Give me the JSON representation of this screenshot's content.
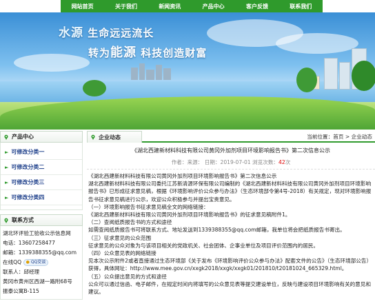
{
  "nav": {
    "items": [
      "网站首页",
      "关于我们",
      "新闻资讯",
      "产品中心",
      "客户反馈",
      "联系我们"
    ]
  },
  "banner": {
    "slogan1_a": "水源",
    "slogan1_b": "生命远远流长",
    "slogan2_a": "转为",
    "slogan2_b": "能源",
    "slogan2_c": "科技创造财富"
  },
  "sidebar": {
    "products_title": "产品中心",
    "categories": [
      "可修改分类一",
      "可修改分类二",
      "可修改分类三",
      "可修改分类四"
    ],
    "contact_title": "联系方式",
    "contact_lines": [
      "湖北环评验工验收公示信息网",
      "电话：13607258477",
      "邮箱：1339388355@qq.com",
      "在线QQ",
      "联系人：邱经理",
      "黄冈市黄州区西湖一路附68号",
      "振泰公寓B-115"
    ],
    "qq_badge": "QQ交谈"
  },
  "content": {
    "tab_title": "企业动态",
    "breadcrumb_prefix": "当前位置：",
    "breadcrumb_home": "首页",
    "breadcrumb_sep": " > ",
    "breadcrumb_current": "企业动态",
    "article_title": "《湖北西建新材料科技有限公司黄冈外加剂项目环境影响报告书》第二次信息公示",
    "meta_author": "作者：来源：",
    "meta_date": "日期：2019-07-01",
    "meta_views_label": "浏览次数：",
    "meta_views": "42",
    "meta_views_suffix": "次",
    "paragraphs": [
      "《湖北西建新材料科技有限公司黄冈外加剂项目环境影响报告书》第二次信息公示",
      "湖北西建新材料科技有限公司委托江苏新清源环保有限公司编制的《湖北西建新材料科技有限公司黄冈外加剂项目环境影响报告书》已形成征求意见稿，根据《环境影响评价公众参与办法》（生态环境部令第4号-2018）有关规定，现对环境影响报告书征求意见稿进行公示，欢迎公众积极参与并提出宝贵意见。",
      "（一）环境影响报告书征求意见稿全文的网络链接：",
      "《湖北西建新材料科技有限公司黄冈外加剂项目环境影响报告书》的征求意见稿附件1。",
      "（二）查阅纸质报告书的方式和途径",
      "如需查阅纸质报告书可将联系方式、地址发送到1339388355@qq.com邮箱，我单位将会把纸质报告书寄出。",
      "（三）征求意见的公众范围",
      "征求意见的公众对象为与该项目相关的党政机关、社会团体、企事业单位及项目评价范围内的居民。",
      "（四）公众意见表的网络链接",
      "见本次公示附件2或者直接通过生态环境部《关于发布《环境影响评价公众参与办法》配套文件的公告》（生态环境部公告）获得，具体网址：http://www.mee.gov.cn/xxgk2018/xxgk/xxgk01/201810/t20181024_665329.html。",
      "（五）公众提出意见的方式和途径",
      "公众可以通过信函、电子邮件，在规定时间内将填写的公众意见表等提交建设单位，反映与建设项目环境影响有关的意见和建议。"
    ]
  }
}
